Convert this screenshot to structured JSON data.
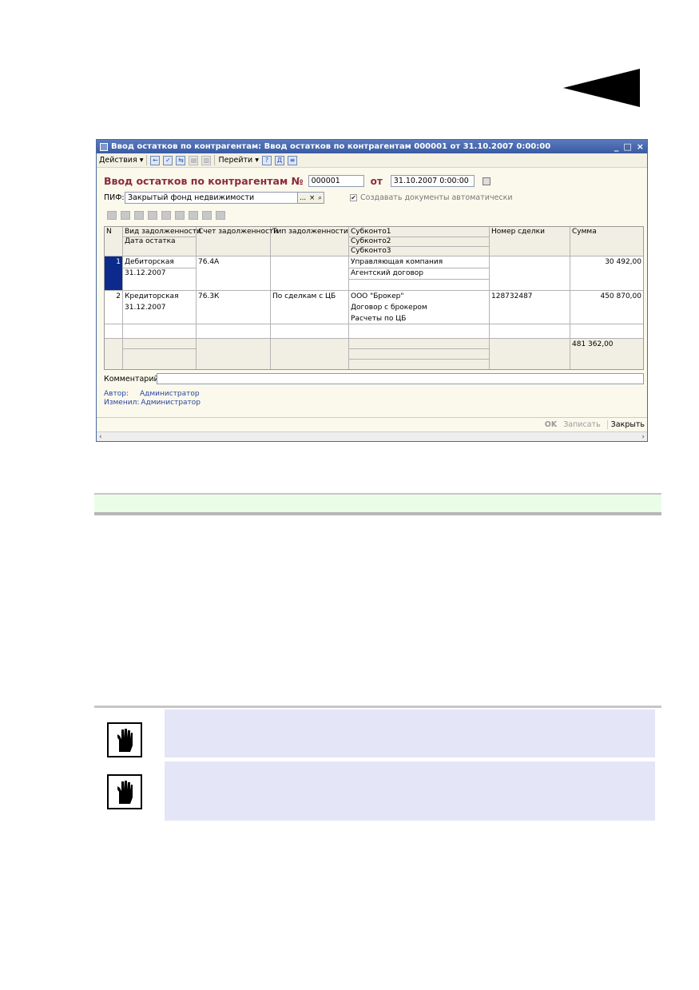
{
  "window": {
    "title": "Ввод остатков по контрагентам: Ввод остатков по контрагентам 000001 от 31.10.2007 0:00:00",
    "controls": [
      "_",
      "□",
      "×"
    ]
  },
  "toolbar": {
    "actions_label": "Действия ▾",
    "goto_label": "Перейти ▾"
  },
  "form": {
    "title": "Ввод остатков по контрагентам №",
    "number": "000001",
    "date_prefix": "от",
    "date": "31.10.2007  0:00:00",
    "pif_label": "ПИФ:",
    "pif_value": "Закрытый фонд недвижимости",
    "pif_btn_select": "...",
    "pif_btn_clear": "×",
    "checkbox_mark": "✔",
    "auto_docs_label": "Создавать документы автоматически",
    "comment_label": "Комментарий:",
    "author_label": "Автор:",
    "author_value": "Администратор",
    "changed_label": "Изменил:",
    "changed_value": "Администратор"
  },
  "table": {
    "headers": {
      "n": "N",
      "vid": "Вид задолженности",
      "date": "Дата остатка",
      "schet": "Счет задолженности",
      "tip": "Тип задолженности",
      "sub1": "Субконто1",
      "sub2": "Субконто2",
      "sub3": "Субконто3",
      "deal": "Номер сделки",
      "sum": "Сумма"
    },
    "rows": [
      {
        "n": "1",
        "vid": "Дебиторская",
        "date": "31.12.2007",
        "schet": "76.4А",
        "tip": "",
        "sub1": "Управляющая компания",
        "sub2": "Агентский договор",
        "sub3": "",
        "deal": "",
        "sum": "30 492,00"
      },
      {
        "n": "2",
        "vid": "Кредиторская",
        "date": "31.12.2007",
        "schet": "76.3К",
        "tip": "По сделкам с ЦБ",
        "sub1": "ООО \"Брокер\"",
        "sub2": "Договор с брокером",
        "sub3": "Расчеты по ЦБ",
        "deal": "128732487",
        "sum": "450 870,00"
      }
    ],
    "total_sum": "481 362,00"
  },
  "bottom": {
    "ok_label": "OK",
    "save_label": "Записать",
    "close_label": "Закрыть"
  }
}
